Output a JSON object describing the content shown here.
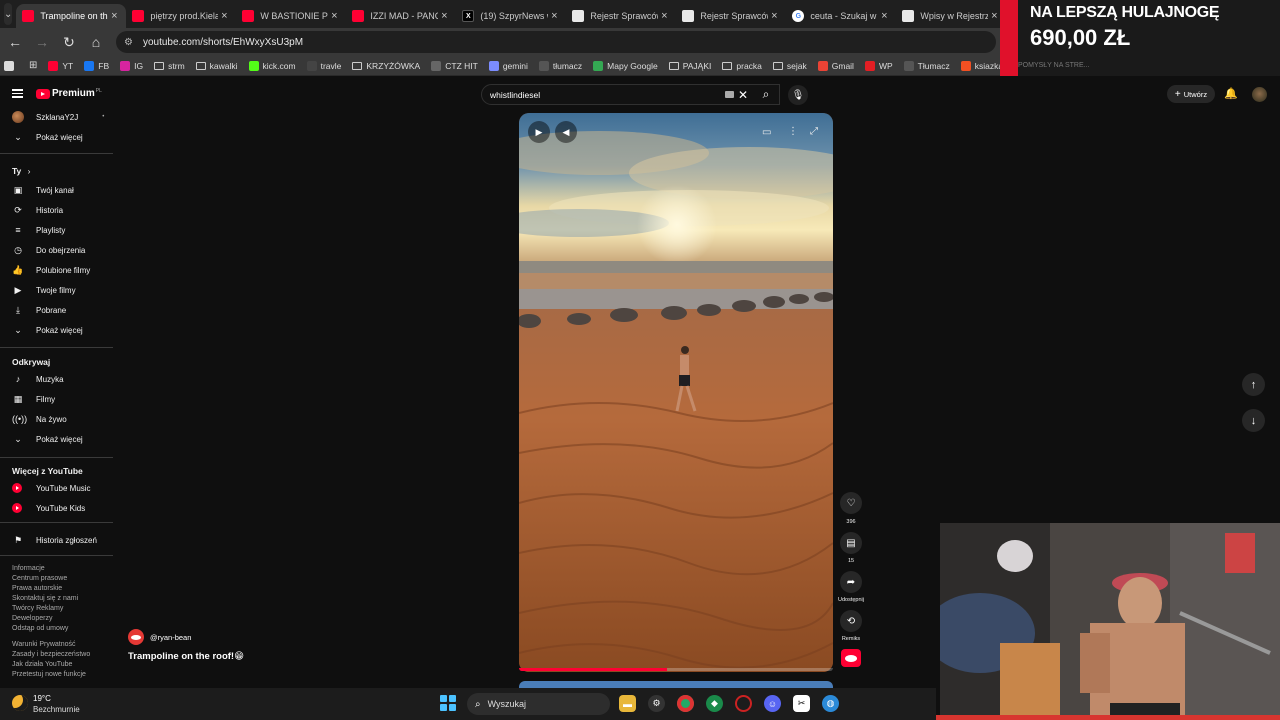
{
  "tabs": [
    {
      "title": "Trampoline on the",
      "favicon": "youtube-icon",
      "active": true
    },
    {
      "title": "piętrzy prod.Kiela",
      "favicon": "youtube-icon"
    },
    {
      "title": "W BASTIONIE PiS",
      "favicon": "youtube-icon"
    },
    {
      "title": "IZZI MAD - PANCI",
      "favicon": "youtube-icon"
    },
    {
      "title": "(19) SzpyrNews w",
      "favicon": "x-icon"
    },
    {
      "title": "Rejestr Sprawców",
      "favicon": "doc-icon"
    },
    {
      "title": "Rejestr Sprawców",
      "favicon": "doc-icon"
    },
    {
      "title": "ceuta - Szukaj w G",
      "favicon": "google-icon"
    },
    {
      "title": "Wpisy w Rejestrze",
      "favicon": "doc-icon"
    }
  ],
  "tab_close_glyph": "×",
  "address": {
    "url": "youtube.com/shorts/EhWxyXsU3pM"
  },
  "bookmarks": [
    {
      "label": "YT",
      "icon": "youtube-icon"
    },
    {
      "label": "FB",
      "icon": "facebook-icon"
    },
    {
      "label": "IG",
      "icon": "instagram-icon"
    },
    {
      "label": "strm",
      "icon": "folder-icon"
    },
    {
      "label": "kawalki",
      "icon": "folder-icon"
    },
    {
      "label": "kick.com",
      "icon": "kick-icon"
    },
    {
      "label": "travle",
      "icon": "globe-icon"
    },
    {
      "label": "KRZYŻÓWKA",
      "icon": "folder-icon"
    },
    {
      "label": "CTZ HIT",
      "icon": "puzzle-icon"
    },
    {
      "label": "gemini",
      "icon": "gemini-icon"
    },
    {
      "label": "tłumacz",
      "icon": "translate-icon"
    },
    {
      "label": "Mapy Google",
      "icon": "maps-icon"
    },
    {
      "label": "PAJĄKI",
      "icon": "folder-icon"
    },
    {
      "label": "pracka",
      "icon": "folder-icon"
    },
    {
      "label": "sejak",
      "icon": "folder-icon"
    },
    {
      "label": "Gmail",
      "icon": "gmail-icon"
    },
    {
      "label": "WP",
      "icon": "wp-icon"
    },
    {
      "label": "Tłumacz",
      "icon": "translate-icon"
    },
    {
      "label": "ksiazka",
      "icon": "windows-icon"
    }
  ],
  "ad": {
    "line1": "NA LEPSZĄ HULAJNOGĘ",
    "line2": "690,00 ZŁ",
    "sub": "POMYSŁY NA STRE..."
  },
  "yt": {
    "logo_text": "Premium",
    "logo_sup": "PL",
    "account_name": "SzklanaY2J",
    "show_more": "Pokaż więcej",
    "you_heading": "Ty",
    "you_items": [
      "Twój kanał",
      "Historia",
      "Playlisty",
      "Do obejrzenia",
      "Polubione filmy",
      "Twoje filmy",
      "Pobrane",
      "Pokaż więcej"
    ],
    "explore_heading": "Odkrywaj",
    "explore_items": [
      "Muzyka",
      "Filmy",
      "Na żywo",
      "Pokaż więcej"
    ],
    "more_heading": "Więcej z YouTube",
    "more_items": [
      "YouTube Music",
      "YouTube Kids"
    ],
    "report_history": "Historia zgłoszeń",
    "footer1": [
      "Informacje",
      "Centrum prasowe",
      "Prawa autorskie",
      "Skontaktuj się z nami",
      "Twórcy  Reklamy",
      "Deweloperzy",
      "Odstąp od umowy"
    ],
    "footer2": [
      "Warunki  Prywatność",
      "Zasady i bezpieczeństwo",
      "Jak działa YouTube",
      "Przetestuj nowe funkcje"
    ],
    "search_value": "whistlindiesel",
    "create_label": "Utwórz"
  },
  "short": {
    "channel": "@ryan-bean",
    "title": "Trampoline on the roof!😁",
    "likes": "396",
    "comments": "15",
    "share_label": "Udostępnij",
    "remix_label": "Remiks",
    "progress": 0.47
  },
  "taskbar": {
    "temp": "19°C",
    "weather": "Bezchmurnie",
    "search_label": "Wyszukaj"
  },
  "colors": {
    "accent": "#ff0033",
    "page_bg": "#0f0f0f",
    "ad_red": "#e0112b"
  }
}
